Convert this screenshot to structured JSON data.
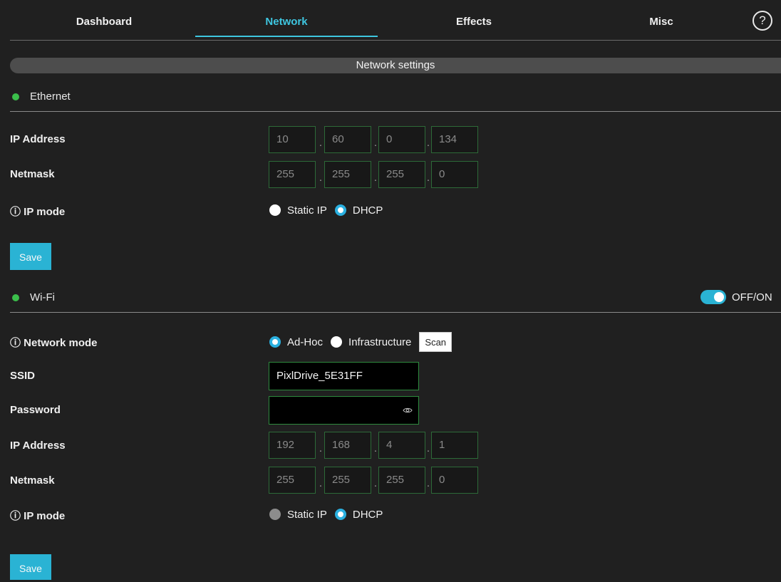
{
  "tabs": [
    {
      "label": "Dashboard"
    },
    {
      "label": "Network"
    },
    {
      "label": "Effects"
    },
    {
      "label": "Misc"
    }
  ],
  "help_label": "?",
  "banner": "Network settings",
  "ethernet": {
    "title": "Ethernet",
    "status_color": "#3bbf4b",
    "ip_label": "IP Address",
    "ip": [
      "10",
      "60",
      "0",
      "134"
    ],
    "netmask_label": "Netmask",
    "netmask": [
      "255",
      "255",
      "255",
      "0"
    ],
    "ipmode_label": "ⓘ IP mode",
    "static_label": "Static IP",
    "dhcp_label": "DHCP",
    "ipmode_selected": "DHCP",
    "save_label": "Save"
  },
  "wifi": {
    "title": "Wi-Fi",
    "status_color": "#3bbf4b",
    "toggle_label": "OFF/ON",
    "toggle_on": true,
    "netmode_label": "ⓘ Network mode",
    "adhoc_label": "Ad-Hoc",
    "infra_label": "Infrastructure",
    "netmode_selected": "Ad-Hoc",
    "scan_label": "Scan",
    "ssid_label": "SSID",
    "ssid": "PixlDrive_5E31FF",
    "password_label": "Password",
    "password": "",
    "ip_label": "IP Address",
    "ip": [
      "192",
      "168",
      "4",
      "1"
    ],
    "netmask_label": "Netmask",
    "netmask": [
      "255",
      "255",
      "255",
      "0"
    ],
    "ipmode_label": "ⓘ IP mode",
    "static_label": "Static IP",
    "dhcp_label": "DHCP",
    "ipmode_selected": "DHCP",
    "save_label": "Save"
  },
  "colors": {
    "accent": "#2ab3d4",
    "active_tab": "#3ec6e0",
    "background": "#202020"
  }
}
